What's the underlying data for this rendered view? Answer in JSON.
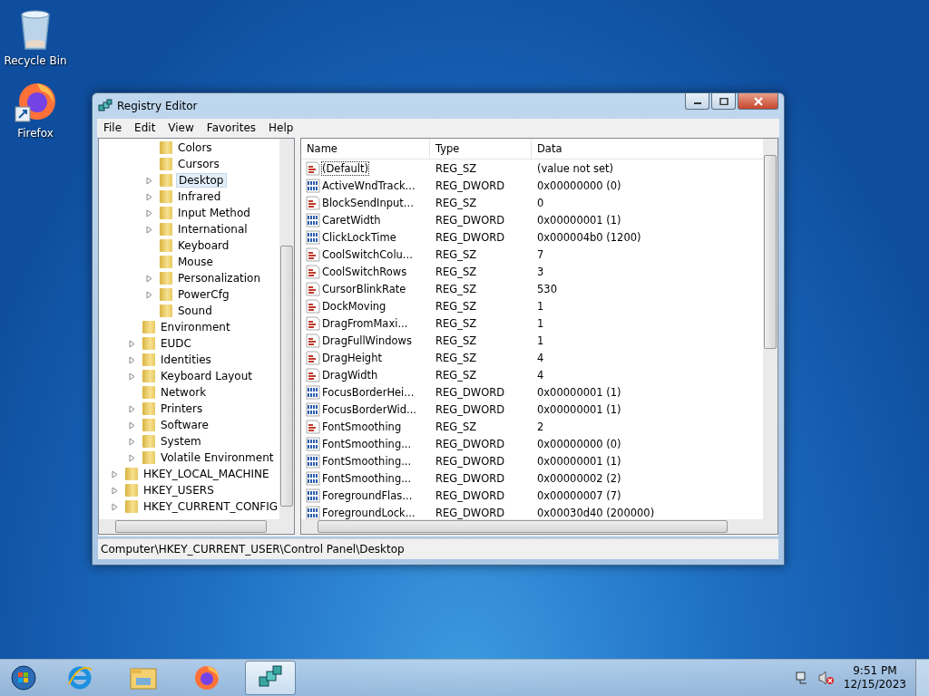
{
  "desktop_icons": [
    {
      "kind": "recycle",
      "label": "Recycle Bin"
    },
    {
      "kind": "firefox",
      "label": "Firefox"
    }
  ],
  "window": {
    "title": "Registry Editor"
  },
  "menu": [
    "File",
    "Edit",
    "View",
    "Favorites",
    "Help"
  ],
  "tree": [
    {
      "children": [
        {
          "children": [
            {
              "label": "Colors",
              "expandable": false,
              "selected": false
            },
            {
              "label": "Cursors",
              "expandable": false,
              "selected": false
            },
            {
              "label": "Desktop",
              "expandable": true,
              "selected": true
            },
            {
              "label": "Infrared",
              "expandable": true,
              "selected": false
            },
            {
              "label": "Input Method",
              "expandable": true,
              "selected": false
            },
            {
              "label": "International",
              "expandable": true,
              "selected": false
            },
            {
              "label": "Keyboard",
              "expandable": false,
              "selected": false
            },
            {
              "label": "Mouse",
              "expandable": false,
              "selected": false
            },
            {
              "label": "Personalization",
              "expandable": true,
              "selected": false
            },
            {
              "label": "PowerCfg",
              "expandable": true,
              "selected": false
            },
            {
              "label": "Sound",
              "expandable": false,
              "selected": false
            }
          ]
        },
        {
          "label": "Environment",
          "expandable": false,
          "selected": false
        },
        {
          "label": "EUDC",
          "expandable": true,
          "selected": false
        },
        {
          "label": "Identities",
          "expandable": true,
          "selected": false
        },
        {
          "label": "Keyboard Layout",
          "expandable": true,
          "selected": false
        },
        {
          "label": "Network",
          "expandable": false,
          "selected": false
        },
        {
          "label": "Printers",
          "expandable": true,
          "selected": false
        },
        {
          "label": "Software",
          "expandable": true,
          "selected": false
        },
        {
          "label": "System",
          "expandable": true,
          "selected": false
        },
        {
          "label": "Volatile Environment",
          "expandable": true,
          "selected": false
        }
      ]
    },
    {
      "label": "HKEY_LOCAL_MACHINE",
      "expandable": true,
      "selected": false
    },
    {
      "label": "HKEY_USERS",
      "expandable": true,
      "selected": false
    },
    {
      "label": "HKEY_CURRENT_CONFIG",
      "expandable": true,
      "selected": false
    }
  ],
  "table": {
    "columns": [
      "Name",
      "Type",
      "Data"
    ],
    "rows": [
      {
        "kind": "sz",
        "name": "(Default)",
        "type": "REG_SZ",
        "data": "(value not set)",
        "selected": true
      },
      {
        "kind": "dword",
        "name": "ActiveWndTrack...",
        "type": "REG_DWORD",
        "data": "0x00000000 (0)",
        "selected": false
      },
      {
        "kind": "sz",
        "name": "BlockSendInput...",
        "type": "REG_SZ",
        "data": "0",
        "selected": false
      },
      {
        "kind": "dword",
        "name": "CaretWidth",
        "type": "REG_DWORD",
        "data": "0x00000001 (1)",
        "selected": false
      },
      {
        "kind": "dword",
        "name": "ClickLockTime",
        "type": "REG_DWORD",
        "data": "0x000004b0 (1200)",
        "selected": false
      },
      {
        "kind": "sz",
        "name": "CoolSwitchColu...",
        "type": "REG_SZ",
        "data": "7",
        "selected": false
      },
      {
        "kind": "sz",
        "name": "CoolSwitchRows",
        "type": "REG_SZ",
        "data": "3",
        "selected": false
      },
      {
        "kind": "sz",
        "name": "CursorBlinkRate",
        "type": "REG_SZ",
        "data": "530",
        "selected": false
      },
      {
        "kind": "sz",
        "name": "DockMoving",
        "type": "REG_SZ",
        "data": "1",
        "selected": false
      },
      {
        "kind": "sz",
        "name": "DragFromMaxi...",
        "type": "REG_SZ",
        "data": "1",
        "selected": false
      },
      {
        "kind": "sz",
        "name": "DragFullWindows",
        "type": "REG_SZ",
        "data": "1",
        "selected": false
      },
      {
        "kind": "sz",
        "name": "DragHeight",
        "type": "REG_SZ",
        "data": "4",
        "selected": false
      },
      {
        "kind": "sz",
        "name": "DragWidth",
        "type": "REG_SZ",
        "data": "4",
        "selected": false
      },
      {
        "kind": "dword",
        "name": "FocusBorderHei...",
        "type": "REG_DWORD",
        "data": "0x00000001 (1)",
        "selected": false
      },
      {
        "kind": "dword",
        "name": "FocusBorderWid...",
        "type": "REG_DWORD",
        "data": "0x00000001 (1)",
        "selected": false
      },
      {
        "kind": "sz",
        "name": "FontSmoothing",
        "type": "REG_SZ",
        "data": "2",
        "selected": false
      },
      {
        "kind": "dword",
        "name": "FontSmoothing...",
        "type": "REG_DWORD",
        "data": "0x00000000 (0)",
        "selected": false
      },
      {
        "kind": "dword",
        "name": "FontSmoothing...",
        "type": "REG_DWORD",
        "data": "0x00000001 (1)",
        "selected": false
      },
      {
        "kind": "dword",
        "name": "FontSmoothing...",
        "type": "REG_DWORD",
        "data": "0x00000002 (2)",
        "selected": false
      },
      {
        "kind": "dword",
        "name": "ForegroundFlas...",
        "type": "REG_DWORD",
        "data": "0x00000007 (7)",
        "selected": false
      },
      {
        "kind": "dword",
        "name": "ForegroundLock...",
        "type": "REG_DWORD",
        "data": "0x00030d40 (200000)",
        "selected": false
      }
    ]
  },
  "status_bar": "Computer\\HKEY_CURRENT_USER\\Control Panel\\Desktop",
  "taskbar": {
    "items": [
      {
        "kind": "ie",
        "selected": false
      },
      {
        "kind": "explorer",
        "selected": false
      },
      {
        "kind": "firefox",
        "selected": false
      },
      {
        "kind": "regedit",
        "selected": true
      }
    ],
    "time": "9:51 PM",
    "date": "12/15/2023"
  }
}
